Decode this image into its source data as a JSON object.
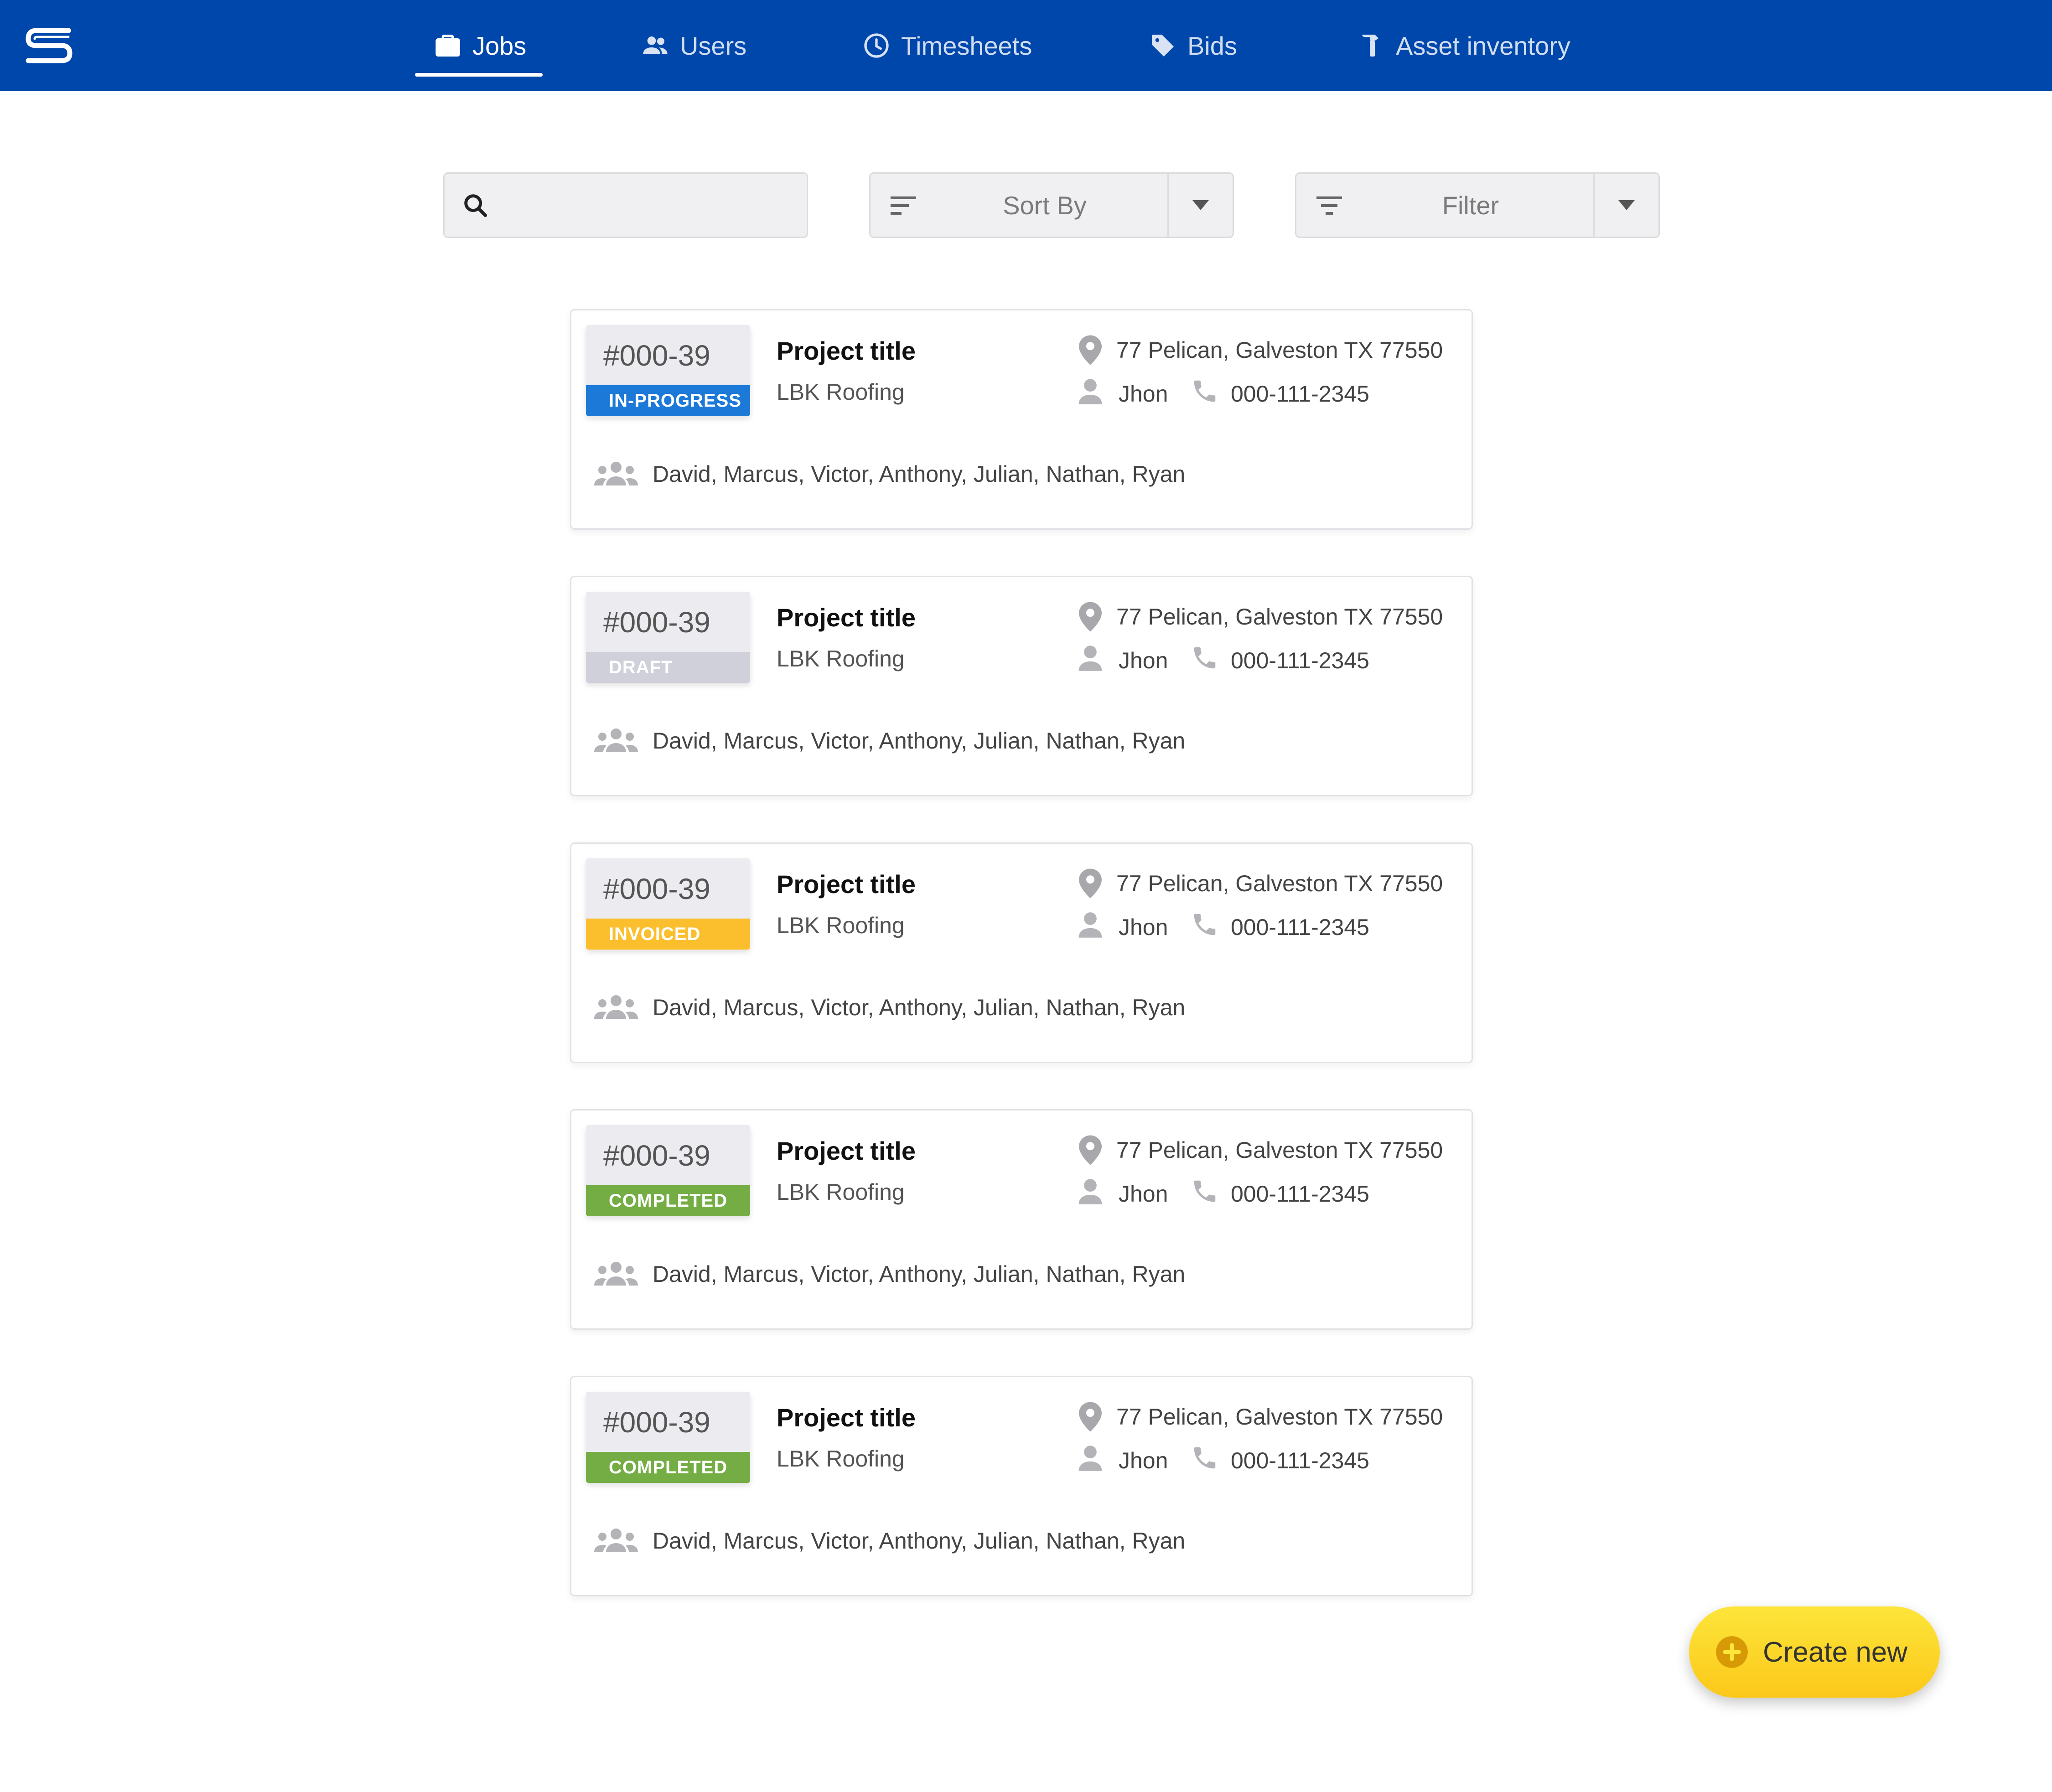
{
  "nav": {
    "items": [
      {
        "label": "Jobs",
        "icon": "briefcase-icon",
        "active": true
      },
      {
        "label": "Users",
        "icon": "users-icon",
        "active": false
      },
      {
        "label": "Timesheets",
        "icon": "clock-icon",
        "active": false
      },
      {
        "label": "Bids",
        "icon": "tag-icon",
        "active": false
      },
      {
        "label": "Asset inventory",
        "icon": "hammer-icon",
        "active": false
      }
    ]
  },
  "controls": {
    "search_placeholder": "",
    "sort_label": "Sort By",
    "filter_label": "Filter"
  },
  "jobs": [
    {
      "number": "#000-39",
      "status": "IN-PROGRESS",
      "status_color": "#1c79d8",
      "title": "Project title",
      "company": "LBK Roofing",
      "address": "77 Pelican, Galveston TX 77550",
      "contact": "Jhon",
      "phone": "000-111-2345",
      "team": "David, Marcus, Victor, Anthony, Julian, Nathan, Ryan"
    },
    {
      "number": "#000-39",
      "status": "DRAFT",
      "status_color": "#cfd0d9",
      "title": "Project title",
      "company": "LBK Roofing",
      "address": "77 Pelican, Galveston TX 77550",
      "contact": "Jhon",
      "phone": "000-111-2345",
      "team": "David, Marcus, Victor, Anthony, Julian, Nathan, Ryan"
    },
    {
      "number": "#000-39",
      "status": "INVOICED",
      "status_color": "#fbbf2e",
      "title": "Project title",
      "company": "LBK Roofing",
      "address": "77 Pelican, Galveston TX 77550",
      "contact": "Jhon",
      "phone": "000-111-2345",
      "team": "David, Marcus, Victor, Anthony, Julian, Nathan, Ryan"
    },
    {
      "number": "#000-39",
      "status": "COMPLETED",
      "status_color": "#74ad44",
      "title": "Project title",
      "company": "LBK Roofing",
      "address": "77 Pelican, Galveston TX 77550",
      "contact": "Jhon",
      "phone": "000-111-2345",
      "team": "David, Marcus, Victor, Anthony, Julian, Nathan, Ryan"
    },
    {
      "number": "#000-39",
      "status": "COMPLETED",
      "status_color": "#74ad44",
      "title": "Project title",
      "company": "LBK Roofing",
      "address": "77 Pelican, Galveston TX 77550",
      "contact": "Jhon",
      "phone": "000-111-2345",
      "team": "David, Marcus, Victor, Anthony, Julian, Nathan, Ryan"
    }
  ],
  "fab": {
    "label": "Create new"
  },
  "colors": {
    "nav_bg": "#0047ab",
    "accent_yellow": "#fbc81a"
  }
}
